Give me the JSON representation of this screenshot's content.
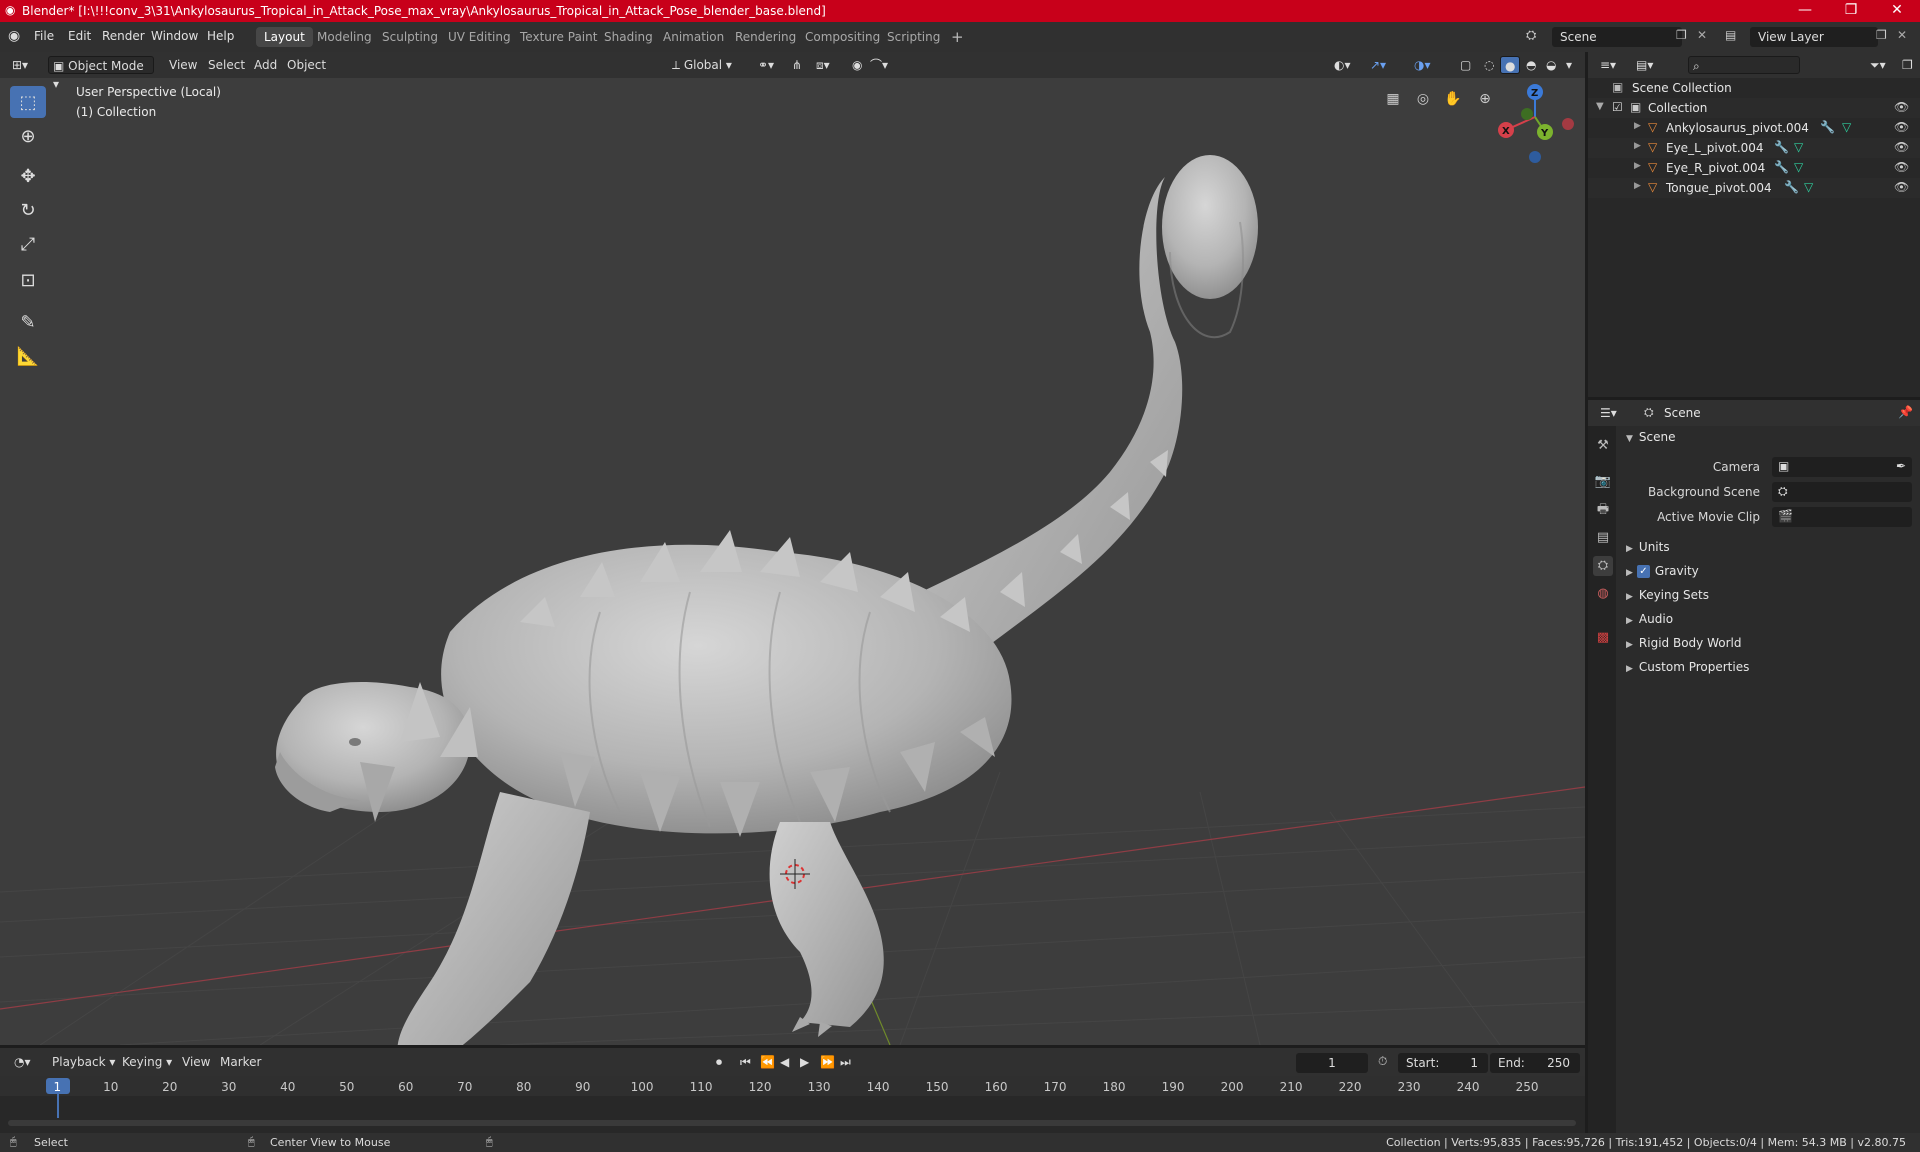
{
  "window": {
    "title": "Blender* [I:\\!!!conv_3\\31\\Ankylosaurus_Tropical_in_Attack_Pose_max_vray\\Ankylosaurus_Tropical_in_Attack_Pose_blender_base.blend]",
    "minimize": "—",
    "maximize": "❐",
    "close": "✕"
  },
  "menu": [
    "File",
    "Edit",
    "Render",
    "Window",
    "Help"
  ],
  "workspaces": [
    "Layout",
    "Modeling",
    "Sculpting",
    "UV Editing",
    "Texture Paint",
    "Shading",
    "Animation",
    "Rendering",
    "Compositing",
    "Scripting"
  ],
  "active_workspace": "Layout",
  "add_workspace": "+",
  "scene_field": "Scene",
  "view_layer_field": "View Layer",
  "viewport": {
    "mode": "Object Mode",
    "menus": [
      "View",
      "Select",
      "Add",
      "Object"
    ],
    "orientation": "Global",
    "overlay_line1": "User Perspective (Local)",
    "overlay_line2": "(1) Collection",
    "gizmo": {
      "x": "X",
      "y": "Y",
      "z": "Z"
    }
  },
  "outliner": {
    "root": "Scene Collection",
    "collection": "Collection",
    "objects": [
      "Ankylosaurus_pivot.004",
      "Eye_L_pivot.004",
      "Eye_R_pivot.004",
      "Tongue_pivot.004"
    ]
  },
  "properties": {
    "header": "Scene",
    "panel": "Scene",
    "camera_label": "Camera",
    "background_scene_label": "Background Scene",
    "active_movie_clip_label": "Active Movie Clip",
    "subpanels": [
      "Units",
      "Gravity",
      "Keying Sets",
      "Audio",
      "Rigid Body World",
      "Custom Properties"
    ],
    "gravity_checked": true
  },
  "timeline": {
    "menus": [
      "Playback",
      "Keying",
      "View",
      "Marker"
    ],
    "current_frame": "1",
    "start_label": "Start:",
    "start_value": "1",
    "end_label": "End:",
    "end_value": "250",
    "ticks": [
      "1",
      "10",
      "20",
      "30",
      "40",
      "50",
      "60",
      "70",
      "80",
      "90",
      "100",
      "110",
      "120",
      "130",
      "140",
      "150",
      "160",
      "170",
      "180",
      "190",
      "200",
      "210",
      "220",
      "230",
      "240",
      "250"
    ]
  },
  "statusbar": {
    "select": "Select",
    "center_view": "Center View to Mouse",
    "stats": "Collection | Verts:95,835 | Faces:95,726 | Tris:191,452 | Objects:0/4 | Mem: 54.3 MB | v2.80.75"
  },
  "colors": {
    "titlebar": "#c8001a",
    "accent": "#4772b3",
    "object_icon": "#e8893a",
    "modifier_icon": "#5b8ee6",
    "mesh_icon": "#2fcf9e"
  }
}
